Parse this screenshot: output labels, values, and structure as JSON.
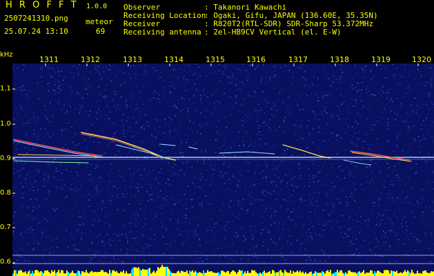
{
  "header": {
    "brand": "H R O F F T",
    "version": "1.0.0",
    "filename": "2507241310.png",
    "datetime": "25.07.24 13:10",
    "mode_label": "meteor",
    "count": "69",
    "fields": [
      {
        "label": "Observer",
        "value": ": Takanori Kawachi"
      },
      {
        "label": "Receiving Location",
        "value": ": Ogaki, Gifu, JAPAN (136.60E, 35.35N)"
      },
      {
        "label": "Receiver",
        "value": ": R820T2(RTL-SDR) SDR-Sharp 53.372MHz"
      },
      {
        "label": "Receiving antenna",
        "value": ": 2el-HB9CV Vertical (el. E-W)"
      }
    ]
  },
  "axes": {
    "y_unit": "kHz",
    "y_ticks": [
      "1.1",
      "1.0",
      "0.9",
      "0.8",
      "0.7",
      "0.6"
    ],
    "x_ticks": [
      "1311",
      "1312",
      "1313",
      "1314",
      "1315",
      "1316",
      "1317",
      "1318",
      "1319",
      "1320"
    ]
  },
  "colors": {
    "background": "#000000",
    "noise_dark": "#0a1060",
    "noise_light": "#2233aa",
    "carrier": "#e8f4ff",
    "label": "#ffff00",
    "bars": "#ffff00",
    "bars_base": "#00e5ff"
  }
}
